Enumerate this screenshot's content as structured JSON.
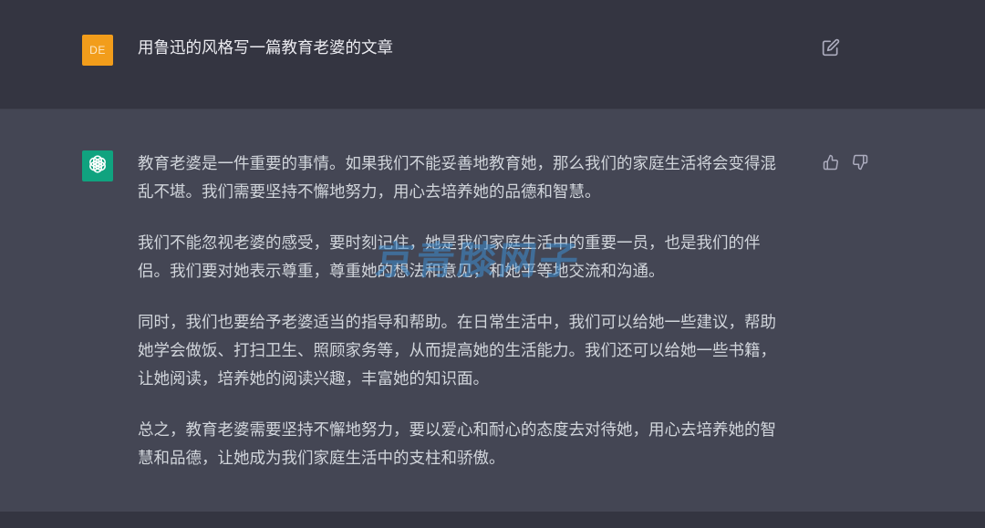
{
  "user_message": {
    "avatar_initials": "DE",
    "avatar_color": "#f29d1b",
    "text": "用鲁迅的风格写一篇教育老婆的文章",
    "edit_icon": "edit-icon"
  },
  "assistant_message": {
    "avatar_icon": "openai-logo-icon",
    "avatar_color": "#10a37f",
    "paragraphs": [
      "教育老婆是一件重要的事情。如果我们不能妥善地教育她，那么我们的家庭生活将会变得混\n乱不堪。我们需要坚持不懈地努力，用心去培养她的品德和智慧。",
      "我们不能忽视老婆的感受，要时刻记住，她是我们家庭生活中的重要一员，也是我们的伴\n侣。我们要对她表示尊重，尊重她的想法和意见，和她平等地交流和沟通。",
      "同时，我们也要给予老婆适当的指导和帮助。在日常生活中，我们可以给她一些建议，帮助\n她学会做饭、打扫卫生、照顾家务等，从而提高她的生活能力。我们还可以给她一些书籍，\n让她阅读，培养她的阅读兴趣，丰富她的知识面。",
      "总之，教育老婆需要坚持不懈地努力，要以爱心和耐心的态度去对待她，用心去培养她的智\n慧和品德，让她成为我们家庭生活中的支柱和骄傲。"
    ],
    "feedback_icons": [
      "thumbs-up-icon",
      "thumbs-down-icon"
    ]
  },
  "watermark": "京青膝网子",
  "colors": {
    "user_bg": "#343541",
    "assistant_bg": "#444654",
    "text": "#d1d5db"
  }
}
